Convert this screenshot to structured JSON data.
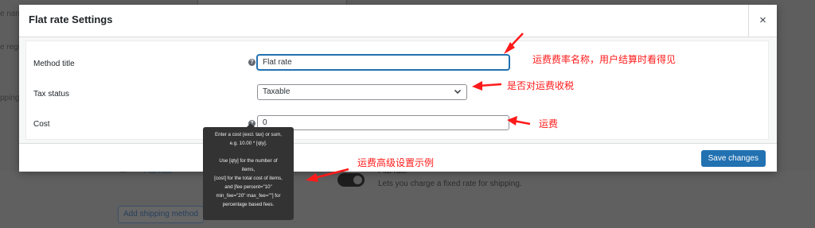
{
  "modal": {
    "title": "Flat rate Settings",
    "close_symbol": "×",
    "fields": {
      "method_title": {
        "label": "Method title",
        "value": "Flat rate"
      },
      "tax_status": {
        "label": "Tax status",
        "selected": "Taxable"
      },
      "cost": {
        "label": "Cost",
        "value": "0"
      }
    },
    "help_symbol": "?",
    "save_label": "Save changes"
  },
  "tooltip": {
    "lines": [
      "Enter a cost (excl. tax) or sum,",
      "e.g. 10.00 * [qty].",
      "",
      "Use [qty] for the number of",
      "items,",
      "[cost] for the total cost of items,",
      "and [fee percent=\"10\"",
      "min_fee=\"20\" max_fee=\"\"] for",
      "percentage based fees."
    ]
  },
  "annotations": {
    "method_title_note": "运费费率名称，用户结算时看得见",
    "tax_status_note": "是否对运费收税",
    "cost_note": "运费",
    "advanced_note": "运费高级设置示例"
  },
  "background": {
    "label_1": "e nam",
    "label_2": "e regi",
    "label_3": "pping",
    "method_name": "Flat rate",
    "method_name_2": "Flat rate",
    "method_description": "Lets you charge a fixed rate for shipping.",
    "add_method_button": "Add shipping method"
  },
  "colors": {
    "accent": "#2271b1",
    "annotation": "#ff1a1a",
    "tooltip_bg": "#333333",
    "overlay": "#5e5e5e"
  }
}
